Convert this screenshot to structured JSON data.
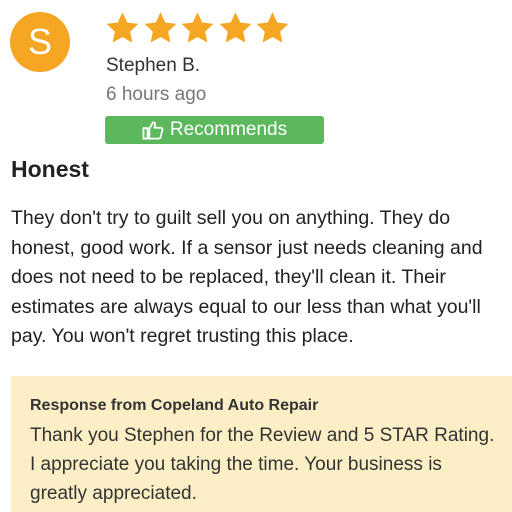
{
  "review": {
    "avatar_letter": "S",
    "avatar_color": "#f5a623",
    "rating": 5,
    "max_rating": 5,
    "star_color": "#f5a623",
    "reviewer": "Stephen B.",
    "time": "6 hours ago",
    "recommend_icon": "thumbs-up-icon",
    "recommend_label": "Recommends",
    "recommend_color": "#5cb85c",
    "title": "Honest",
    "text": "They don't try to guilt sell you on anything. They do honest, good work. If a sensor just needs cleaning and does not need to be replaced, they'll clean it. Their estimates are always equal to our less than what you'll pay. You won't regret trusting this place."
  },
  "response": {
    "heading": "Response from Copeland Auto Repair",
    "text": "Thank you Stephen for the Review and 5 STAR Rating. I appreciate you taking the time. Your business is greatly appreciated.",
    "background": "#fcefc6"
  }
}
